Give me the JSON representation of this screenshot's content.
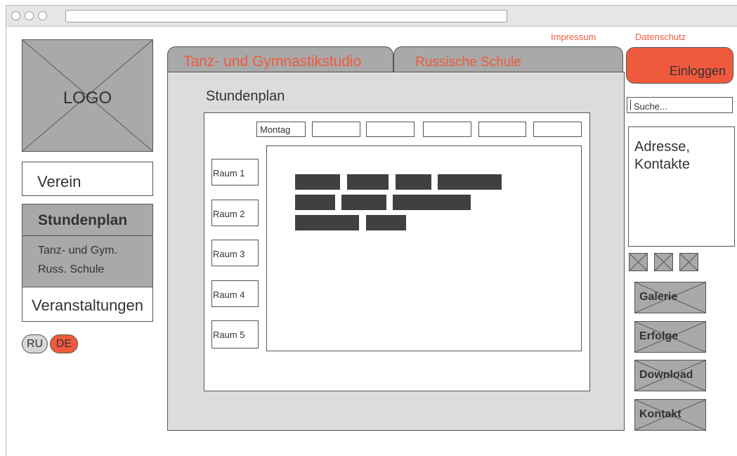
{
  "header": {
    "impressum": "Impressum",
    "datenschutz": "Datenschutz",
    "login_label": "Einloggen"
  },
  "logo": {
    "text": "LOGO"
  },
  "sidebar": {
    "verein": "Verein",
    "stundenplan": "Stundenplan",
    "sub_items": [
      "Tanz- und Gym.",
      "Russ. Schule"
    ],
    "veranstaltungen": "Veranstaltungen",
    "languages": [
      "RU",
      "DE"
    ],
    "active_language": "DE"
  },
  "tabs": [
    "Tanz- und Gymnastikstudio",
    "Russische Schule"
  ],
  "main": {
    "title": "Stundenplan",
    "days": [
      "Montag",
      "",
      "",
      "",
      "",
      ""
    ],
    "rooms": [
      "Raum 1",
      "Raum 2",
      "Raum 3",
      "Raum 4",
      "Raum 5"
    ]
  },
  "right": {
    "search_placeholder": "Suche...",
    "address_text": "Adresse, Kontakte",
    "nav": [
      "Galerie",
      "Erfolge",
      "Download",
      "Kontakt"
    ]
  },
  "colors": {
    "accent": "#f05a3c",
    "placeholder_gray": "#a9a9a9",
    "panel_gray": "#dcdcdc",
    "bar_dark": "#404040"
  },
  "icons": [
    "logo-placeholder-icon",
    "social-icon-1",
    "social-icon-2",
    "social-icon-3"
  ]
}
